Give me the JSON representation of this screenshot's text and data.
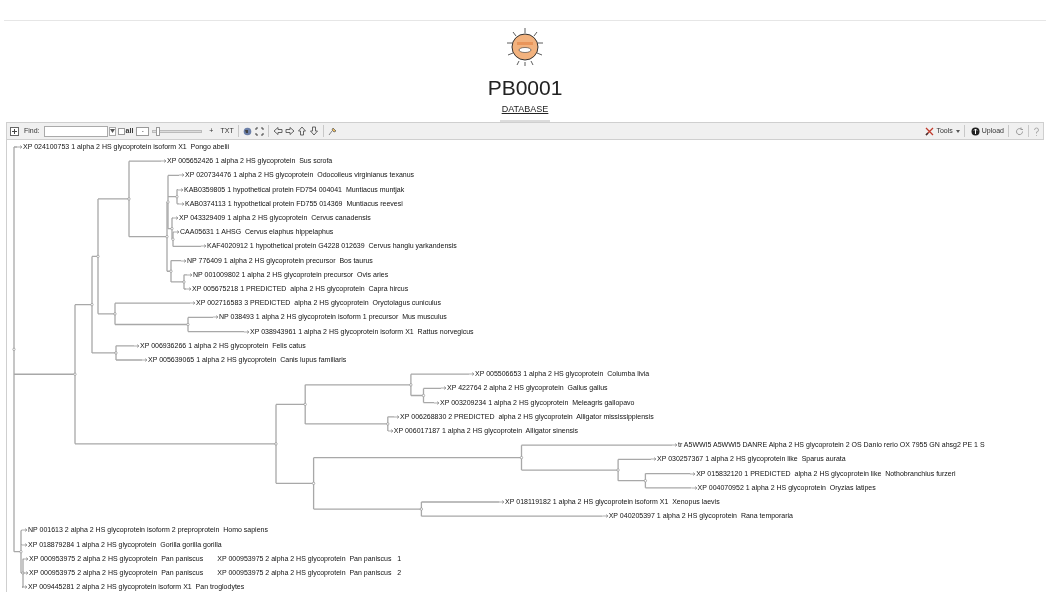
{
  "header": {
    "title": "PB0001",
    "link": "DATABASE"
  },
  "toolbar": {
    "find_label": "Find:",
    "all_checkbox": {
      "label": "all",
      "checked": false
    },
    "zoom_out": "-",
    "zoom_slider": {
      "level": 0.06
    },
    "zoom_in": "+",
    "text_button": "TXT",
    "tools_menu": "Tools",
    "upload_button": "Upload"
  },
  "tree": {
    "children": [
      {
        "labels": [
          "XP 024100753 1 alpha 2 HS glycoprotein isoform X1  Pongo abelii"
        ]
      },
      {
        "children": [
          {
            "children": [
              {
                "children": [
                  {
                    "children": [
                      {
                        "labels": [
                          "XP 005652426 1 alpha 2 HS glycoprotein  Sus scrofa"
                        ]
                      },
                      {
                        "children": [
                          {
                            "children": [
                              {
                                "labels": [
                                  "XP 020734476 1 alpha 2 HS glycoprotein  Odocoileus virginianus texanus"
                                ]
                              },
                              {
                                "children": [
                                  {
                                    "labels": [
                                      "KAB0359805 1 hypothetical protein FD754 004041  Muntiacus muntjak"
                                    ]
                                  },
                                  {
                                    "labels": [
                                      "KAB0374113 1 hypothetical protein FD755 014369  Muntiacus reevesi"
                                    ]
                                  }
                                ]
                              },
                              {
                                "children": [
                                  {
                                    "labels": [
                                      "XP 043329409 1 alpha 2 HS glycoprotein  Cervus canadensis"
                                    ]
                                  },
                                  {
                                    "children": [
                                      {
                                        "labels": [
                                          "CAA05631 1 AHSG  Cervus elaphus hippelaphus"
                                        ]
                                      },
                                      {
                                        "labels": [
                                          "KAF4020912 1 hypothetical protein G4228 012639  Cervus hanglu yarkandensis"
                                        ]
                                      }
                                    ]
                                  }
                                ]
                              }
                            ]
                          },
                          {
                            "children": [
                              {
                                "labels": [
                                  "NP 776409 1 alpha 2 HS glycoprotein precursor  Bos taurus"
                                ]
                              },
                              {
                                "children": [
                                  {
                                    "labels": [
                                      "NP 001009802 1 alpha 2 HS glycoprotein precursor  Ovis aries"
                                    ]
                                  },
                                  {
                                    "labels": [
                                      "XP 005675218 1 PREDICTED  alpha 2 HS glycoprotein  Capra hircus"
                                    ]
                                  }
                                ]
                              }
                            ]
                          }
                        ]
                      }
                    ]
                  },
                  {
                    "children": [
                      {
                        "labels": [
                          "XP 002716583 3 PREDICTED  alpha 2 HS glycoprotein  Oryctolagus cuniculus"
                        ]
                      },
                      {
                        "children": [
                          {
                            "labels": [
                              "NP 038493 1 alpha 2 HS glycoprotein isoform 1 precursor  Mus musculus"
                            ]
                          },
                          {
                            "labels": [
                              "XP 038943961 1 alpha 2 HS glycoprotein isoform X1  Rattus norvegicus"
                            ]
                          }
                        ]
                      }
                    ]
                  }
                ]
              },
              {
                "children": [
                  {
                    "labels": [
                      "XP 006936266 1 alpha 2 HS glycoprotein  Felis catus"
                    ]
                  },
                  {
                    "labels": [
                      "XP 005639065 1 alpha 2 HS glycoprotein  Canis lupus familiaris"
                    ]
                  }
                ]
              }
            ]
          },
          {
            "children": [
              {
                "children": [
                  {
                    "children": [
                      {
                        "labels": [
                          "XP 005506653 1 alpha 2 HS glycoprotein  Columba livia"
                        ]
                      },
                      {
                        "children": [
                          {
                            "labels": [
                              "XP 422764 2 alpha 2 HS glycoprotein  Gallus gallus"
                            ]
                          },
                          {
                            "labels": [
                              "XP 003209234 1 alpha 2 HS glycoprotein  Meleagris gallopavo"
                            ]
                          }
                        ]
                      }
                    ]
                  },
                  {
                    "children": [
                      {
                        "labels": [
                          "XP 006268830 2 PREDICTED  alpha 2 HS glycoprotein  Alligator mississippiensis"
                        ]
                      },
                      {
                        "labels": [
                          "XP 006017187 1 alpha 2 HS glycoprotein  Alligator sinensis"
                        ]
                      }
                    ]
                  }
                ]
              },
              {
                "children": [
                  {
                    "children": [
                      {
                        "labels": [
                          "tr A5WWI5 A5WWI5 DANRE Alpha 2 HS glycoprotein 2 OS Danio rerio OX 7955 GN ahsg2 PE 1 S"
                        ]
                      },
                      {
                        "children": [
                          {
                            "labels": [
                              "XP 030257367 1 alpha 2 HS glycoprotein like  Sparus aurata"
                            ]
                          },
                          {
                            "children": [
                              {
                                "labels": [
                                  "XP 015832120 1 PREDICTED  alpha 2 HS glycoprotein like  Nothobranchius furzeri"
                                ]
                              },
                              {
                                "labels": [
                                  "XP 004070952 1 alpha 2 HS glycoprotein  Oryzias latipes"
                                ]
                              }
                            ]
                          }
                        ]
                      }
                    ]
                  },
                  {
                    "children": [
                      {
                        "labels": [
                          "XP 018119182 1 alpha 2 HS glycoprotein isoform X1  Xenopus laevis"
                        ]
                      },
                      {
                        "labels": [
                          "XP 040205397 1 alpha 2 HS glycoprotein  Rana temporaria"
                        ]
                      }
                    ]
                  }
                ]
              }
            ]
          }
        ]
      },
      {
        "children": [
          {
            "labels": [
              "NP 001613 2 alpha 2 HS glycoprotein isoform 2 preproprotein  Homo sapiens"
            ]
          },
          {
            "labels": [
              "XP 018879284 1 alpha 2 HS glycoprotein  Gorilla gorilla gorilla"
            ]
          },
          {
            "children": [
              {
                "labels": [
                  "XP 000953975 2 alpha 2 HS glycoprotein  Pan paniscus",
                  "XP 000953975 2 alpha 2 HS glycoprotein  Pan paniscus   1"
                ]
              },
              {
                "labels": [
                  "XP 000953975 2 alpha 2 HS glycoprotein  Pan paniscus",
                  "XP 000953975 2 alpha 2 HS glycoprotein  Pan paniscus   2"
                ]
              },
              {
                "labels": [
                  "XP 009445281 2 alpha 2 HS glycoprotein isoform X1  Pan troglodytes"
                ]
              }
            ]
          }
        ]
      }
    ]
  }
}
